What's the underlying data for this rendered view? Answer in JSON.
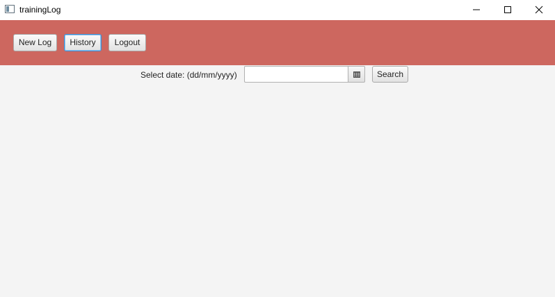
{
  "window": {
    "title": "trainingLog",
    "icon": "java-app-icon",
    "controls": [
      "minimize-icon",
      "maximize-icon",
      "close-icon"
    ]
  },
  "nav": {
    "background_color": "#cd675f",
    "buttons": [
      {
        "label": "New Log"
      },
      {
        "label": "History",
        "focused": true
      },
      {
        "label": "Logout"
      }
    ]
  },
  "search": {
    "label": "Select date: (dd/mm/yyyy)",
    "date_value": "",
    "date_placeholder": "",
    "calendar_icon": "calendar-icon",
    "button_label": "Search"
  }
}
